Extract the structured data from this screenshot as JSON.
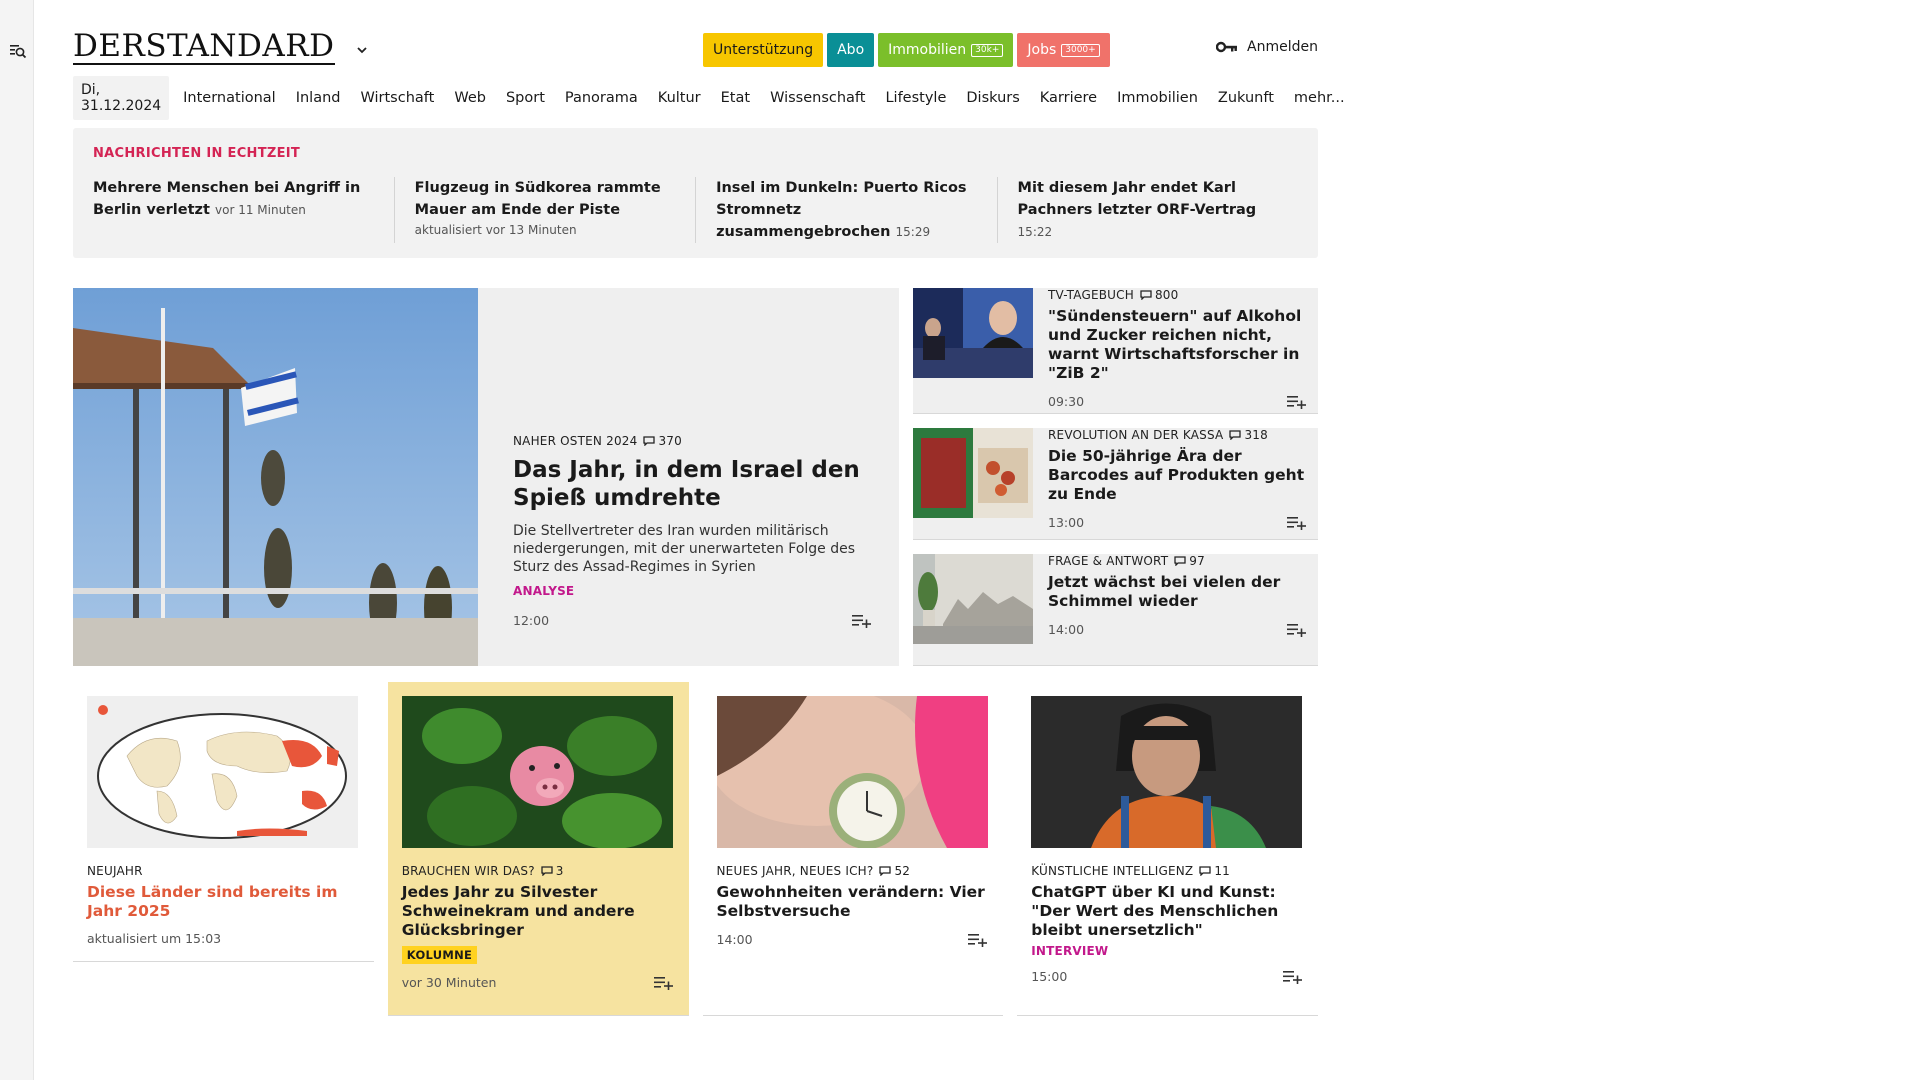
{
  "header": {
    "logo": "DERSTANDARD",
    "top_links": [
      {
        "label": "Unterstützung",
        "badge": "",
        "bg": "#f7c600",
        "fg": "#1a1a1a"
      },
      {
        "label": "Abo",
        "badge": "",
        "bg": "#0a8f96",
        "fg": "#ffffff"
      },
      {
        "label": "Immobilien",
        "badge": "30k+",
        "bg": "#7bbf2a",
        "fg": "#ffffff"
      },
      {
        "label": "Jobs",
        "badge": "3000+",
        "bg": "#f0726a",
        "fg": "#ffffff"
      }
    ],
    "login_label": "Anmelden"
  },
  "nav": {
    "date": "Di, 31.12.2024",
    "items": [
      "International",
      "Inland",
      "Wirtschaft",
      "Web",
      "Sport",
      "Panorama",
      "Kultur",
      "Etat",
      "Wissenschaft",
      "Lifestyle",
      "Diskurs",
      "Karriere",
      "Immobilien",
      "Zukunft",
      "mehr..."
    ]
  },
  "ticker": {
    "title": "NACHRICHTEN IN ECHTZEIT",
    "items": [
      {
        "headline": "Mehrere Menschen bei Angriff in Ber­lin verletzt",
        "time": "vor 11 Minuten",
        "sub": ""
      },
      {
        "headline": "Flugzeug in Südkorea rammte Mauer am Ende der Piste",
        "time": "",
        "sub": "aktualisiert vor 13 Minuten"
      },
      {
        "headline": "Insel im Dunkeln: Puerto Ricos Strom­netz zusammengebrochen",
        "time": "15:29",
        "sub": ""
      },
      {
        "headline": "Mit diesem Jahr endet Karl Pachners letzter ORF-Vertrag",
        "time": "15:22",
        "sub": ""
      }
    ]
  },
  "hero": {
    "kicker": "NAHER OSTEN 2024",
    "comments": "370",
    "title": "Das Jahr, in dem Israel den Spieß umdrehte",
    "lead": "Die Stellvertreter des Iran wurden militärisch nieder­gerungen, mit der unerwarteten Folge des Sturz des Assad-Regimes in Syrien",
    "label": "ANALYSE",
    "time": "12:00"
  },
  "side": [
    {
      "kicker": "TV-TAGEBUCH",
      "comments": "800",
      "title": "\"Sündensteuern\" auf Alkohol und Zucker reichen nicht, warnt Wirtschaftsforscher in \"ZiB 2\"",
      "time": "09:30"
    },
    {
      "kicker": "REVOLUTION AN DER KASSA",
      "comments": "318",
      "title": "Die 50-jährige Ära der Barcodes auf Produkten geht zu Ende",
      "time": "13:00"
    },
    {
      "kicker": "FRAGE & ANTWORT",
      "comments": "97",
      "title": "Jetzt wächst bei vielen der Schimmel wieder",
      "time": "14:00"
    }
  ],
  "cards": [
    {
      "kicker": "NEUJAHR",
      "comments": "",
      "title": "Diese Länder sind bereits im Jahr 2025",
      "label": "",
      "time": "aktualisiert um 15:03"
    },
    {
      "kicker": "BRAUCHEN WIR DAS?",
      "comments": "3",
      "title": "Jedes Jahr zu Silvester Schweinekram und andere Glücksbringer",
      "label": "KOLUMNE",
      "time": "vor 30 Minuten"
    },
    {
      "kicker": "NEUES JAHR, NEUES ICH?",
      "comments": "52",
      "title": "Gewohnheiten verändern: Vier Selbstversuche",
      "label": "",
      "time": "14:00"
    },
    {
      "kicker": "KÜNSTLICHE INTELLIGENZ",
      "comments": "11",
      "title": "ChatGPT über KI und Kunst: \"Der Wert des Menschlichen bleibt unersetzlich\"",
      "label": "INTERVIEW",
      "time": "15:00"
    }
  ],
  "colors": {
    "ticker_red": "#d42454",
    "label_magenta": "#c2188b",
    "kolumne_yellow": "#ffd21f",
    "card_yellow": "#f6e3a0",
    "live_red": "#e05a3a"
  }
}
